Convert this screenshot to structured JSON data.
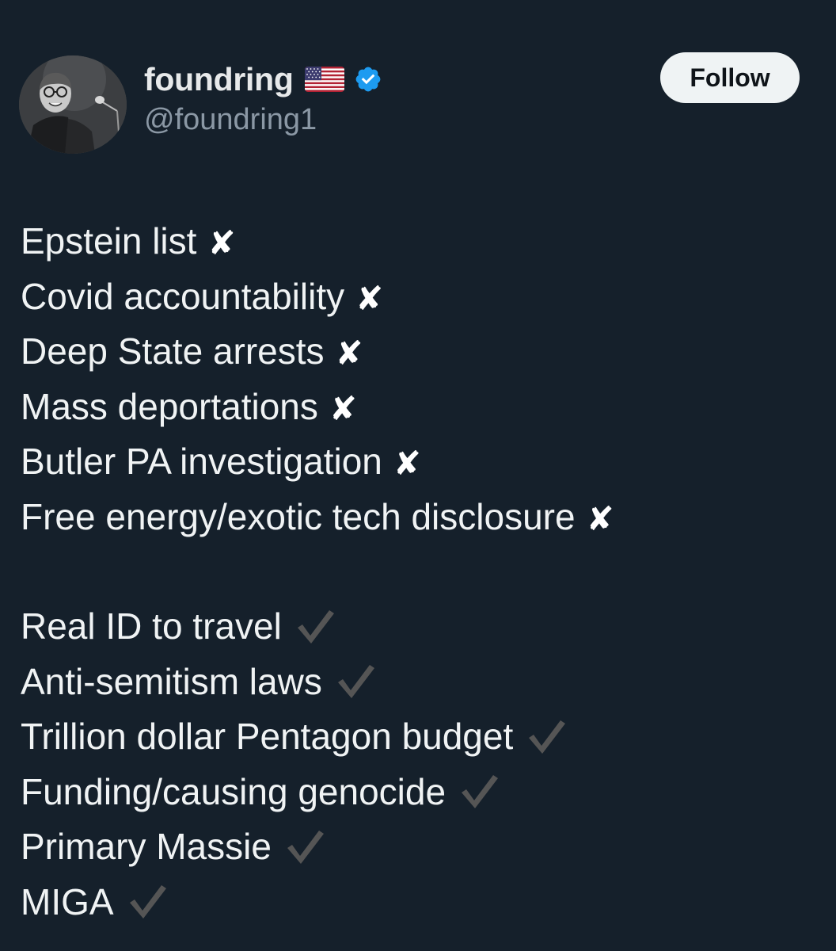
{
  "user": {
    "display_name": "foundring",
    "flag_icon": "us-flag-icon",
    "verified_icon": "verified-badge-icon",
    "handle": "@foundring1",
    "follow_label": "Follow"
  },
  "colors": {
    "background": "#15202b",
    "text": "#e7e9ea",
    "handle": "#8b98a5",
    "verified": "#1d9bf0",
    "check": "#555555"
  },
  "marks": {
    "cross": "✘"
  },
  "tweet": {
    "failed": [
      "Epstein list",
      "Covid accountability",
      "Deep State arrests",
      "Mass deportations",
      "Butler PA investigation",
      "Free energy/exotic tech disclosure"
    ],
    "delivered": [
      "Real ID to travel",
      "Anti-semitism laws",
      "Trillion dollar Pentagon budget",
      "Funding/causing genocide",
      "Primary Massie",
      "MIGA"
    ]
  }
}
